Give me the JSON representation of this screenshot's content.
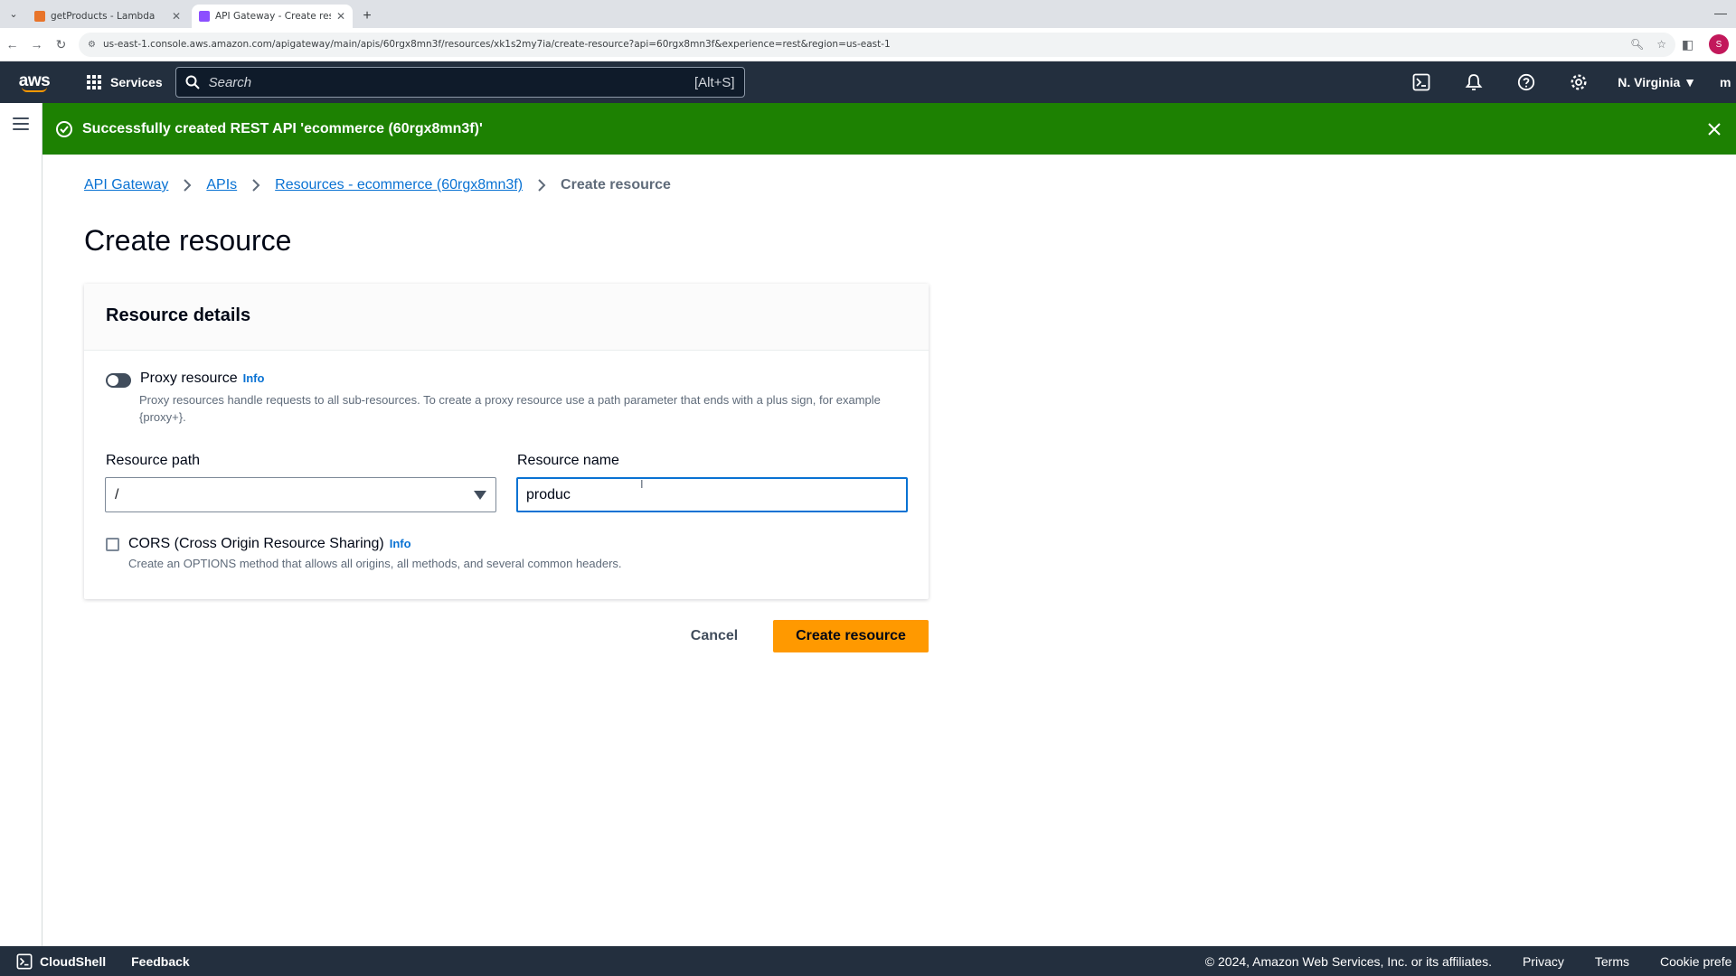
{
  "browser": {
    "tabs": [
      {
        "title": "getProducts - Lambda",
        "favicon_color": "#e8742a",
        "active": false
      },
      {
        "title": "API Gateway - Create resource",
        "favicon_color": "#8c4fff",
        "active": true
      }
    ],
    "new_tab": "+",
    "url": "us-east-1.console.aws.amazon.com/apigateway/main/apis/60rgx8mn3f/resources/xk1s2my7ia/create-resource?api=60rgx8mn3f&experience=rest&region=us-east-1",
    "profile_initial": "S"
  },
  "aws_nav": {
    "logo": "aws",
    "services_label": "Services",
    "search_placeholder": "Search",
    "search_shortcut": "[Alt+S]",
    "region": "N. Virginia ▼",
    "user_stub": "m"
  },
  "flash": {
    "message": "Successfully created REST API 'ecommerce (60rgx8mn3f)'",
    "color": "#1d8102"
  },
  "breadcrumb": {
    "items": [
      "API Gateway",
      "APIs",
      "Resources - ecommerce (60rgx8mn3f)"
    ],
    "current": "Create resource"
  },
  "page_title": "Create resource",
  "resource_details": {
    "heading": "Resource details",
    "proxy": {
      "label": "Proxy resource",
      "info": "Info",
      "description": "Proxy resources handle requests to all sub-resources. To create a proxy resource use a path parameter that ends with a plus sign, for example {proxy+}.",
      "enabled": false
    },
    "resource_path": {
      "label": "Resource path",
      "value": "/"
    },
    "resource_name": {
      "label": "Resource name",
      "value": "produc"
    },
    "cors": {
      "label": "CORS (Cross Origin Resource Sharing)",
      "info": "Info",
      "description": "Create an OPTIONS method that allows all origins, all methods, and several common headers.",
      "checked": false
    }
  },
  "actions": {
    "cancel": "Cancel",
    "submit": "Create resource",
    "accent": "#ff9900"
  },
  "footer": {
    "cloudshell": "CloudShell",
    "feedback": "Feedback",
    "copyright": "© 2024, Amazon Web Services, Inc. or its affiliates.",
    "links": [
      "Privacy",
      "Terms",
      "Cookie prefe"
    ]
  }
}
